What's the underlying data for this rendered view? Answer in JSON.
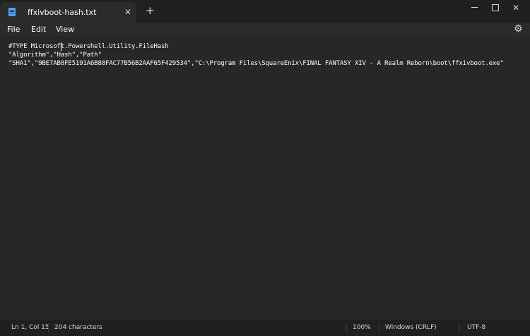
{
  "window": {
    "tab_title": "ffxivboot-hash.txt",
    "close_tab_glyph": "✕",
    "new_tab_glyph": "+",
    "minimize_icon": "minimize-icon",
    "maximize_icon": "maximize-icon",
    "close_glyph": "✕"
  },
  "menu": {
    "file": "File",
    "edit": "Edit",
    "view": "View",
    "settings_glyph": "⚙"
  },
  "editor": {
    "lines": [
      "#TYPE Microsoft.Powershell.Utility.FileHash",
      "\"Algorithm\",\"Hash\",\"Path\"",
      "\"SHA1\",\"9BE7AB8FE5191A6B88FAC77B56B2AAF65F429534\",\"C:\\Program Files\\SquareEnix\\FINAL FANTASY XIV - A Realm Reborn\\boot\\ffxivboot.exe\""
    ]
  },
  "status": {
    "position": "Ln 1, Col 15",
    "characters": "204 characters",
    "zoom": "100%",
    "line_ending": "Windows (CRLF)",
    "encoding": "UTF-8"
  },
  "colors": {
    "titlebar": "#202020",
    "tab_active": "#2b2b2b",
    "editor_bg": "#272727",
    "accent_icon": "#4aa3f5"
  }
}
